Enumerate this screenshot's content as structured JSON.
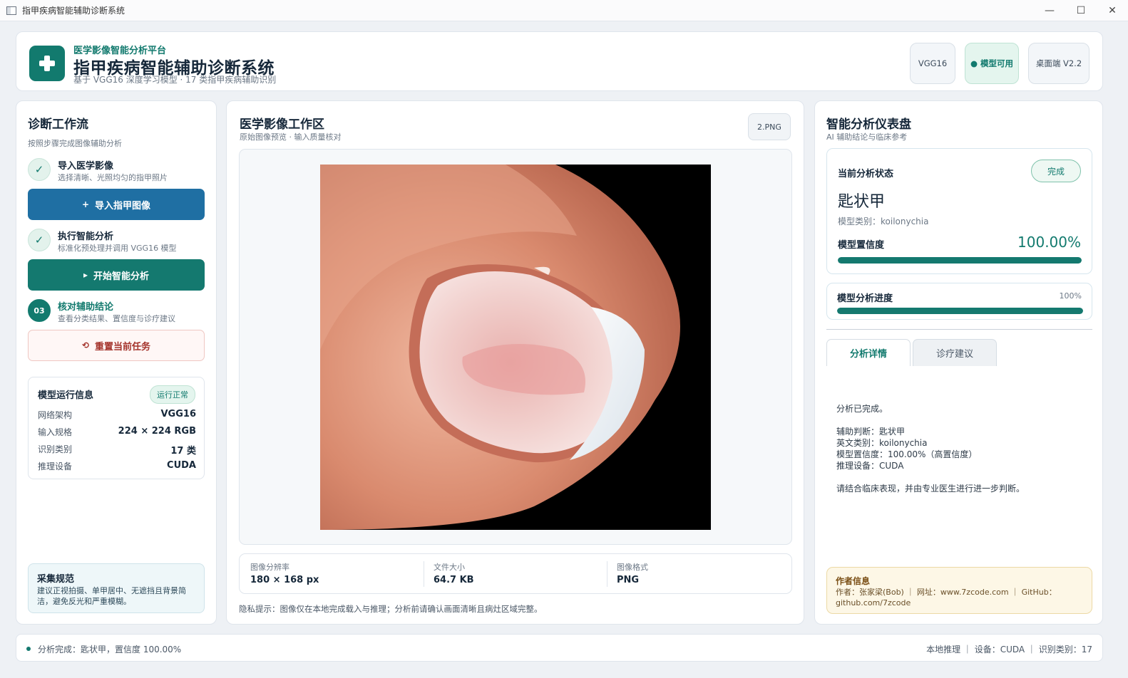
{
  "window": {
    "title": "指甲疾病智能辅助诊断系统",
    "controls": [
      "—",
      "☐",
      "✕"
    ]
  },
  "header": {
    "kicker": "医学影像智能分析平台",
    "title": "指甲疾病智能辅助诊断系统",
    "subtitle": "基于 VGG16 深度学习模型 · 17 类指甲疾病辅助识别",
    "chips": {
      "model": "VGG16",
      "status": "● 模型可用",
      "version": "桌面端 V2.2"
    },
    "logo_icon": "medical-cross-icon"
  },
  "workflow": {
    "title": "诊断工作流",
    "subtitle": "按照步骤完成图像辅助分析",
    "steps": [
      {
        "marker": "✓",
        "title": "导入医学影像",
        "desc": "选择清晰、光照均匀的指甲照片"
      },
      {
        "marker": "✓",
        "title": "执行智能分析",
        "desc": "标准化预处理并调用 VGG16 模型"
      },
      {
        "marker": "03",
        "title": "核对辅助结论",
        "desc": "查看分类结果、置信度与诊疗建议"
      }
    ],
    "import_button": "导入指甲图像",
    "import_icon": "+",
    "analyze_button": "开始智能分析",
    "analyze_icon": "▸",
    "reset_button": "重置当前任务",
    "reset_icon": "⟲"
  },
  "model_info": {
    "title": "模型运行信息",
    "badge": "运行正常",
    "rows": [
      {
        "k": "网络架构",
        "v": "VGG16"
      },
      {
        "k": "输入规格",
        "v": "224 × 224 RGB"
      },
      {
        "k": "识别类别",
        "v": "17 类"
      },
      {
        "k": "推理设备",
        "v": "CUDA"
      }
    ]
  },
  "guidelines": {
    "title": "采集规范",
    "text": "建议正视拍摄、单甲居中、无遮挡且背景简洁，避免反光和严重模糊。"
  },
  "workspace": {
    "title": "医学影像工作区",
    "subtitle": "原始图像预览 · 输入质量核对",
    "file_chip": "2.PNG",
    "meta": [
      {
        "k": "图像分辨率",
        "v": "180 × 168 px"
      },
      {
        "k": "文件大小",
        "v": "64.7 KB"
      },
      {
        "k": "图像格式",
        "v": "PNG"
      }
    ],
    "privacy": "隐私提示：图像仅在本地完成载入与推理；分析前请确认画面清晰且病灶区域完整。"
  },
  "dashboard": {
    "title": "智能分析仪表盘",
    "subtitle": "AI 辅助结论与临床参考",
    "status_label": "当前分析状态",
    "status_pill": "完成",
    "diagnosis": "匙状甲",
    "class_line": "模型类别：koilonychia",
    "confidence_label": "模型置信度",
    "confidence_text": "100.00%",
    "confidence_value": 1.0,
    "progress_label": "模型分析进度",
    "progress_text": "100%",
    "progress_value": 1.0,
    "tabs": [
      "分析详情",
      "诊疗建议"
    ],
    "details": "分析已完成。\n\n辅助判断：匙状甲\n英文类别：koilonychia\n模型置信度：100.00%（高置信度）\n推理设备：CUDA\n\n请结合临床表现，并由专业医生进行进一步判断。"
  },
  "author": {
    "title": "作者信息",
    "text": "作者：张家梁(Bob) ｜ 网址：www.7zcode.com ｜ GitHub：github.com/7zcode"
  },
  "statusbar": {
    "left": "分析完成：匙状甲，置信度 100.00%",
    "right": "本地推理 ｜ 设备：CUDA ｜ 识别类别：17"
  },
  "colors": {
    "accent": "#127a6e",
    "blue": "#1f6fa3",
    "danger": "#a4342c"
  }
}
